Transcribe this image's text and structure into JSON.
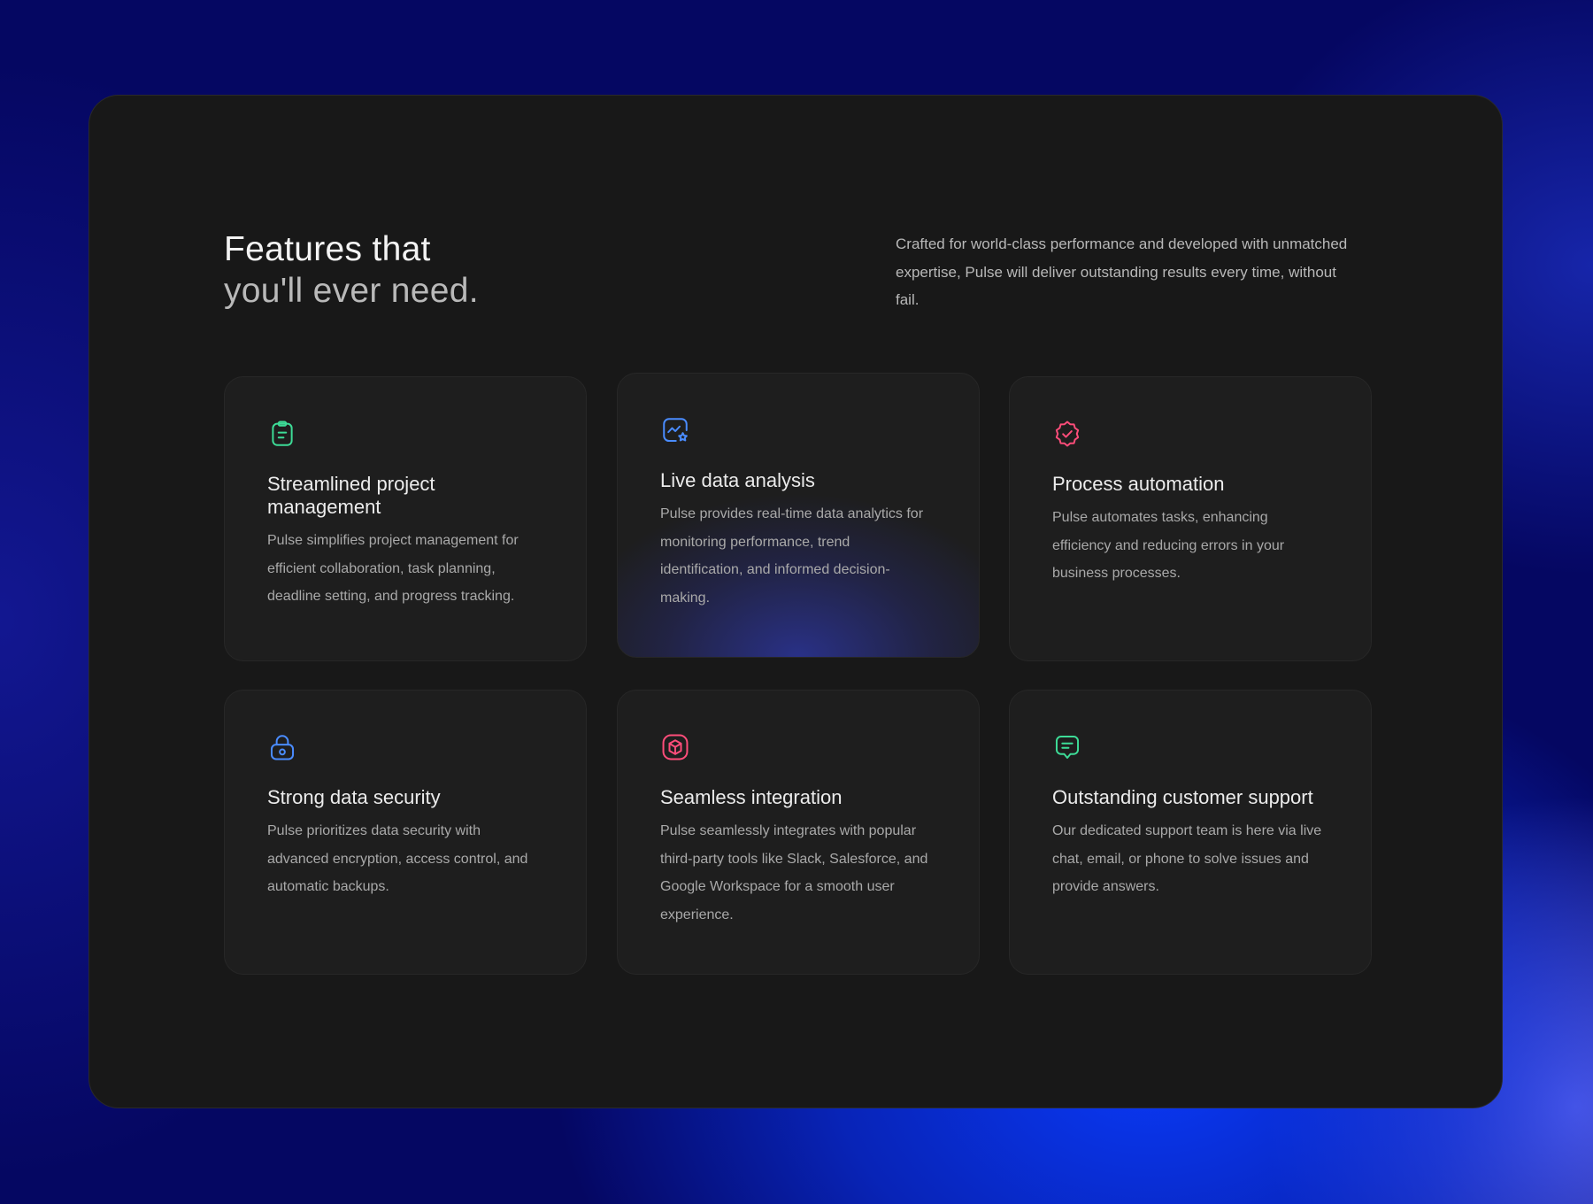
{
  "header": {
    "title_line1": "Features that",
    "title_line2": "you'll ever need.",
    "intro": "Crafted for world-class performance and developed with unmatched expertise, Pulse will deliver outstanding results every time, without fail."
  },
  "colors": {
    "green": "#3ddc97",
    "blue": "#4a8cff",
    "pink": "#ff4d7a"
  },
  "features": [
    {
      "icon": "clipboard-icon",
      "title": "Streamlined project management",
      "description": "Pulse simplifies project management for efficient collaboration, task planning, deadline setting, and progress tracking."
    },
    {
      "icon": "chart-analysis-icon",
      "title": "Live data analysis",
      "description": "Pulse provides real-time data analytics for monitoring performance, trend identification, and informed decision-making."
    },
    {
      "icon": "verified-badge-icon",
      "title": "Process automation",
      "description": "Pulse automates tasks, enhancing efficiency and reducing errors in your business processes."
    },
    {
      "icon": "lock-icon",
      "title": "Strong data security",
      "description": "Pulse prioritizes data security with advanced encryption, access control, and automatic backups."
    },
    {
      "icon": "cube-integration-icon",
      "title": "Seamless integration",
      "description": "Pulse seamlessly integrates with popular third-party tools like Slack, Salesforce, and Google Workspace for a smooth user experience."
    },
    {
      "icon": "chat-message-icon",
      "title": "Outstanding customer support",
      "description": "Our dedicated support team is here via live chat, email, or phone to solve issues and provide answers."
    }
  ]
}
